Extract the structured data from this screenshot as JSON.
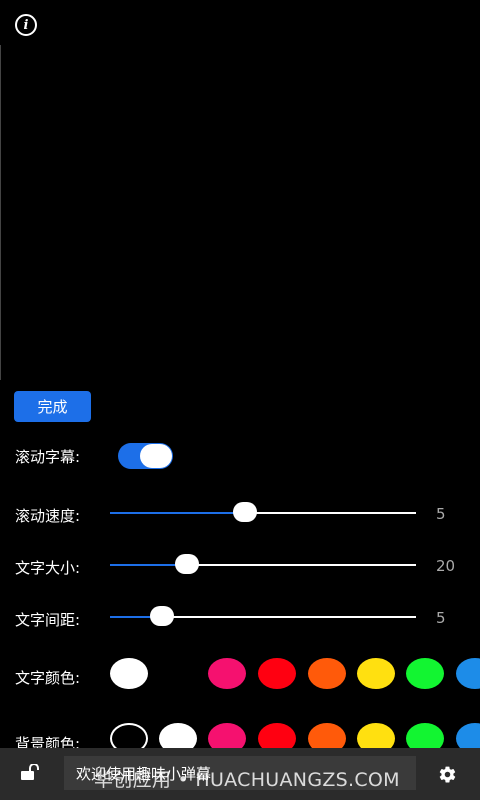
{
  "header": {
    "info_icon": "info-icon",
    "info_glyph": "i"
  },
  "done_button": {
    "label": "完成",
    "color": "#1d6fe8"
  },
  "scroll_toggle": {
    "label": "滚动字幕:",
    "on": true
  },
  "speed": {
    "label": "滚动速度:",
    "value": "5",
    "fraction": 0.44
  },
  "size": {
    "label": "文字大小:",
    "value": "20",
    "fraction": 0.25
  },
  "spacing": {
    "label": "文字间距:",
    "value": "5",
    "fraction": 0.17
  },
  "text_color": {
    "label": "文字颜色:",
    "swatches": [
      "#ffffff",
      "#f5116f",
      "#ff0011",
      "#ff5a0a",
      "#ffe010",
      "#12f531",
      "#1d8ce8"
    ]
  },
  "bg_color": {
    "label": "背景颜色:",
    "swatches": [
      "#000000",
      "#ffffff",
      "#f5116f",
      "#ff0011",
      "#ff5a0a",
      "#ffe010",
      "#12f531",
      "#1d8ce8"
    ]
  },
  "bottom_bar": {
    "lock_icon": "unlock-icon",
    "input_value": "欢迎使用趣味小弹幕",
    "gear_icon": "gear-icon"
  },
  "watermark": {
    "text": "华创应用 • HUACHUANGZS.COM"
  }
}
